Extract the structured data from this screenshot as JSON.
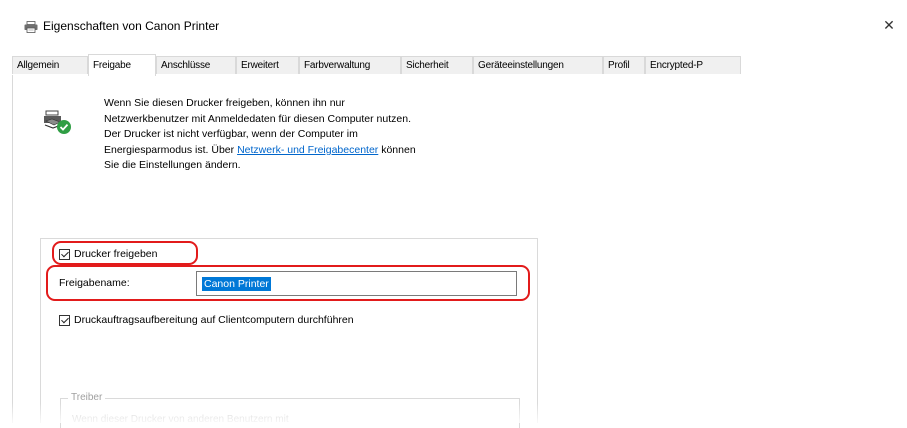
{
  "window": {
    "title": "Eigenschaften von Canon Printer",
    "close_glyph": "✕"
  },
  "tabs": [
    {
      "label": "Allgemein",
      "active": false
    },
    {
      "label": "Freigabe",
      "active": true
    },
    {
      "label": "Anschlüsse",
      "active": false
    },
    {
      "label": "Erweitert",
      "active": false
    },
    {
      "label": "Farbverwaltung",
      "active": false
    },
    {
      "label": "Sicherheit",
      "active": false
    },
    {
      "label": "Geräteeinstellungen",
      "active": false
    },
    {
      "label": "Profil",
      "active": false
    },
    {
      "label": "Encrypted-P",
      "active": false
    }
  ],
  "info": {
    "line1": "Wenn Sie diesen Drucker freigeben, können ihn nur",
    "line2": "Netzwerkbenutzer mit Anmeldedaten für diesen Computer nutzen.",
    "line3": "Der Drucker ist nicht verfügbar, wenn der Computer im",
    "line4_prefix": "Energiesparmodus ist. Über ",
    "link": "Netzwerk- und Freigabecenter",
    "line4_suffix": " können",
    "line5": "Sie die Einstellungen ändern."
  },
  "share": {
    "checkbox_label": "Drucker freigeben",
    "checked": true,
    "name_label": "Freigabename:",
    "name_value": "Canon Printer"
  },
  "render_jobs": {
    "label": "Druckauftragsaufbereitung auf Clientcomputern durchführen",
    "checked": true
  },
  "driver": {
    "group_label": "Treiber",
    "text": "Wenn dieser Drucker von anderen Benutzern mit"
  },
  "colors": {
    "highlight": "#e21b1b",
    "selection": "#0078d7",
    "link": "#0066cc"
  }
}
